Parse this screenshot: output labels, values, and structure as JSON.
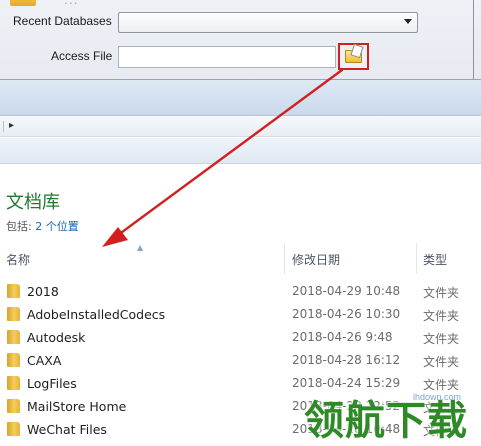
{
  "dialog": {
    "faded_title": "...",
    "recent_databases_label": "Recent Databases",
    "recent_databases_value": "",
    "access_file_label": "Access File",
    "access_file_value": ""
  },
  "library": {
    "title": "文档库",
    "includes_prefix": "包括:",
    "includes_link": "2 个位置"
  },
  "columns": {
    "name": "名称",
    "date": "修改日期",
    "type": "类型"
  },
  "files": [
    {
      "name": "2018",
      "date": "2018-04-29 10:48",
      "type": "文件夹"
    },
    {
      "name": "AdobeInstalledCodecs",
      "date": "2018-04-26 10:30",
      "type": "文件夹"
    },
    {
      "name": "Autodesk",
      "date": "2018-04-26 9:48",
      "type": "文件夹"
    },
    {
      "name": "CAXA",
      "date": "2018-04-28 16:12",
      "type": "文件夹"
    },
    {
      "name": "LogFiles",
      "date": "2018-04-24 15:29",
      "type": "文件夹"
    },
    {
      "name": "MailStore Home",
      "date": "2018-04-28 12:52",
      "type": "文件夹"
    },
    {
      "name": "WeChat Files",
      "date": "2018-04-28 10:48",
      "type": "文件夹"
    }
  ],
  "watermark": {
    "logo_text": "领航下载",
    "url": "lhdown.com"
  },
  "colors": {
    "highlight_red": "#d22020",
    "library_title_green": "#1e7a2e",
    "watermark_green": "#2e8a27",
    "folder_yellow": "#f1bf2f"
  }
}
